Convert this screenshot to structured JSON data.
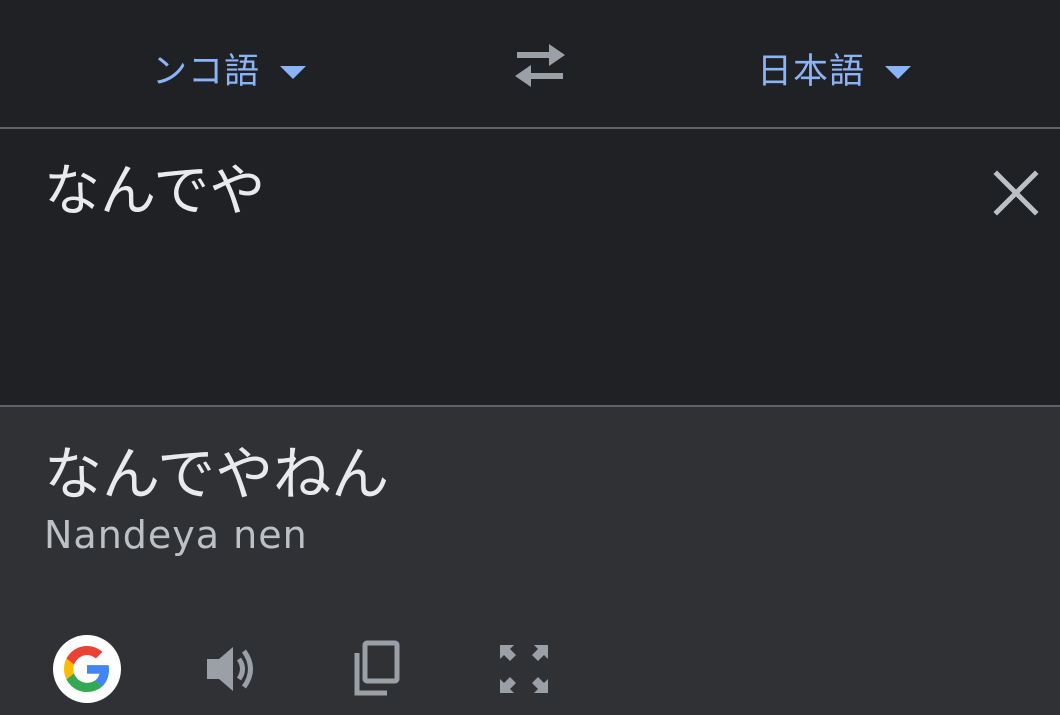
{
  "language_bar": {
    "source_language": "ンコ語",
    "target_language": "日本語",
    "icons": {
      "source_dropdown": "caret-down-icon",
      "swap": "swap-arrows-icon",
      "target_dropdown": "caret-down-icon"
    }
  },
  "input": {
    "text": "なんでや",
    "clear_icon": "close-icon"
  },
  "output": {
    "translation": "なんでやねん",
    "romanization": "Nandeya nen",
    "actions": [
      {
        "name": "google-logo-icon"
      },
      {
        "name": "speaker-icon"
      },
      {
        "name": "copy-icon"
      },
      {
        "name": "fullscreen-icon"
      }
    ]
  },
  "colors": {
    "background": "#202124",
    "output_background": "#303134",
    "accent": "#8ab4f8",
    "text_primary": "#e8eaed",
    "text_secondary": "#bdc1c6",
    "icon_gray": "#9aa0a6",
    "divider": "#5f6368"
  }
}
